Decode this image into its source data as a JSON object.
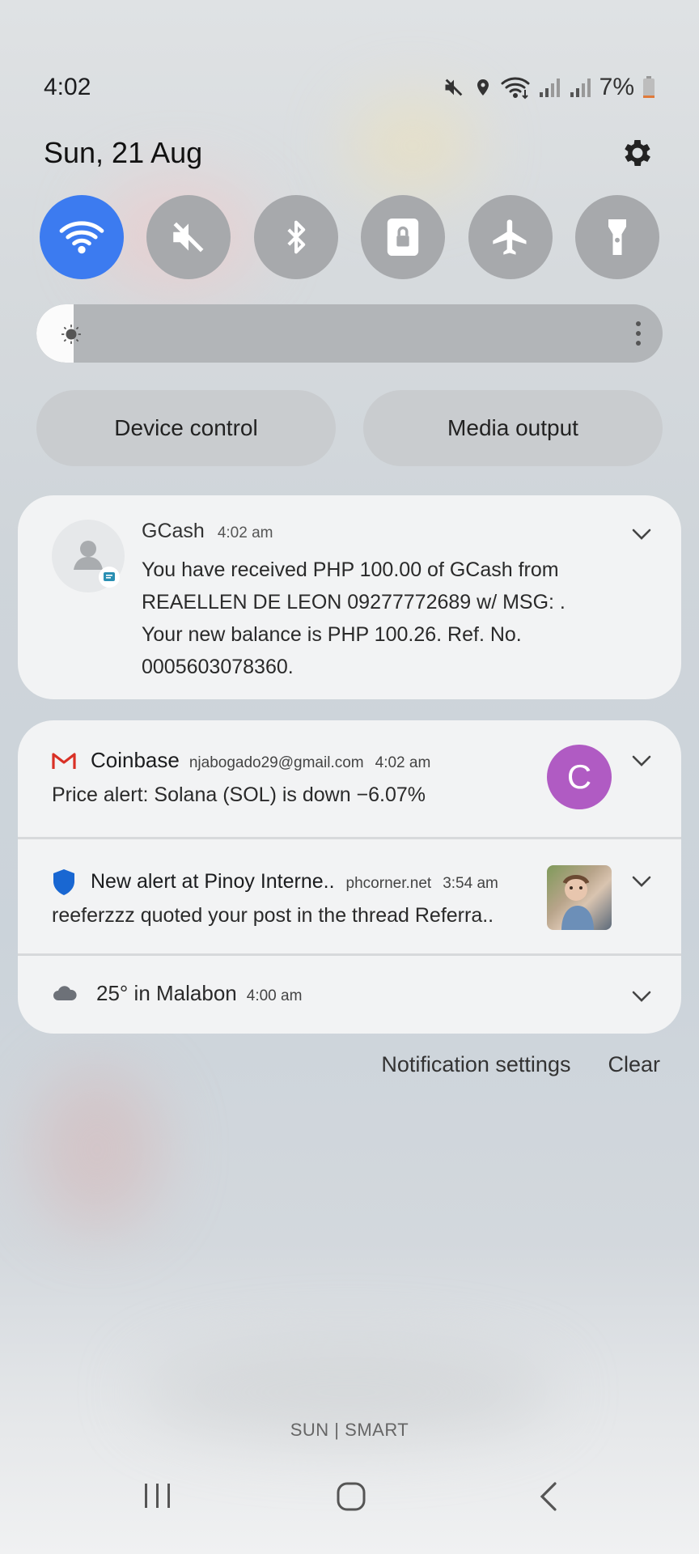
{
  "status_bar": {
    "time": "4:02",
    "battery_percent": "7%",
    "icons": [
      "mute-icon",
      "location-icon",
      "wifi-icon",
      "signal-icon",
      "signal-icon",
      "battery-icon"
    ]
  },
  "header": {
    "date": "Sun, 21 Aug",
    "settings_icon": "gear-icon"
  },
  "quick_tiles": [
    {
      "name": "wifi",
      "icon": "wifi-icon",
      "on": true
    },
    {
      "name": "sound",
      "icon": "mute-icon",
      "on": false
    },
    {
      "name": "bluetooth",
      "icon": "bluetooth-icon",
      "on": false
    },
    {
      "name": "rotation-lock",
      "icon": "lock-icon",
      "on": false
    },
    {
      "name": "airplane",
      "icon": "airplane-icon",
      "on": false
    },
    {
      "name": "flashlight",
      "icon": "flashlight-icon",
      "on": false
    }
  ],
  "brightness": {
    "level": 0.05
  },
  "buttons": {
    "device_control": "Device control",
    "media_output": "Media output"
  },
  "notifications": {
    "gcash": {
      "app": "GCash",
      "time": "4:02 am",
      "line1": "You have received PHP 100.00 of GCash from",
      "line2": "REAELLEN DE LEON 09277772689 w/ MSG: .",
      "line3": "Your new balance is PHP 100.26. Ref. No.",
      "line4": "0005603078360."
    },
    "coinbase": {
      "app": "Coinbase",
      "account": "njabogado29@gmail.com",
      "time": "4:02 am",
      "text": "Price alert: Solana (SOL) is down −6.07%",
      "avatar_letter": "C",
      "avatar_color": "#b05bc3"
    },
    "phcorner": {
      "title": "New alert at Pinoy Interne..",
      "site": "phcorner.net",
      "time": "3:54 am",
      "text": "reeferzzz quoted your post in the thread Referra.."
    },
    "weather": {
      "text": "25° in Malabon",
      "time": "4:00 am"
    }
  },
  "footer": {
    "notification_settings": "Notification settings",
    "clear": "Clear"
  },
  "carrier": "SUN | SMART",
  "colors": {
    "accent": "#3c7bf0",
    "tile_off": "#a7a9ac",
    "gmail_red": "#d93025",
    "shield_blue": "#1967d2"
  }
}
